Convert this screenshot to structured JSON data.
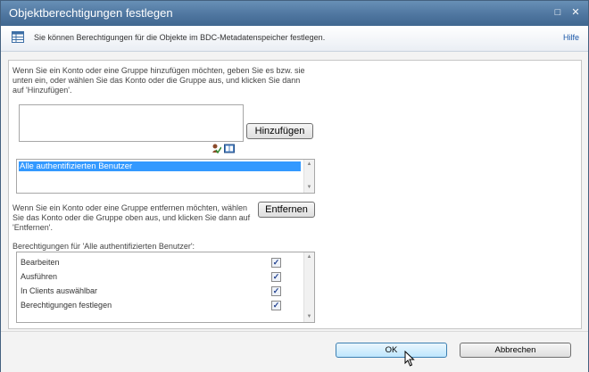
{
  "dialog": {
    "title": "Objektberechtigungen festlegen",
    "maximize_glyph": "□",
    "close_glyph": "✕"
  },
  "infobar": {
    "text": "Sie können Berechtigungen für die Objekte im BDC-Metadatenspeicher festlegen.",
    "help_link": "Hilfe",
    "icon": "table-icon"
  },
  "add_section": {
    "instructions_line1": "Wenn Sie ein Konto oder eine Gruppe hinzufügen möchten, geben Sie es bzw. sie",
    "instructions_line2": "unten ein, oder wählen Sie das Konto oder die Gruppe aus, und klicken Sie dann",
    "instructions_line3": "auf 'Hinzufügen'.",
    "input_value": "",
    "add_button": "Hinzufügen",
    "check_names_icon": "check-names-icon",
    "browse_icon": "address-book-icon"
  },
  "accounts": {
    "items": [
      "Alle authentifizierten Benutzer"
    ],
    "selected_index": 0
  },
  "remove_section": {
    "instructions_line1": "Wenn Sie ein Konto oder eine Gruppe entfernen möchten, wählen",
    "instructions_line2": "Sie das Konto oder die Gruppe oben aus, und klicken Sie dann auf",
    "instructions_line3": "'Entfernen'.",
    "remove_button": "Entfernen"
  },
  "permissions": {
    "label": "Berechtigungen für 'Alle authentifizierten Benutzer':",
    "items": [
      {
        "label": "Bearbeiten",
        "checked": true
      },
      {
        "label": "Ausführen",
        "checked": true
      },
      {
        "label": "In Clients auswählbar",
        "checked": true
      },
      {
        "label": "Berechtigungen festlegen",
        "checked": true
      }
    ]
  },
  "footer": {
    "ok_button": "OK",
    "cancel_button": "Abbrechen"
  },
  "colors": {
    "titlebar": "#4f76a0",
    "selection": "#3399ff",
    "link": "#1a57a8"
  }
}
